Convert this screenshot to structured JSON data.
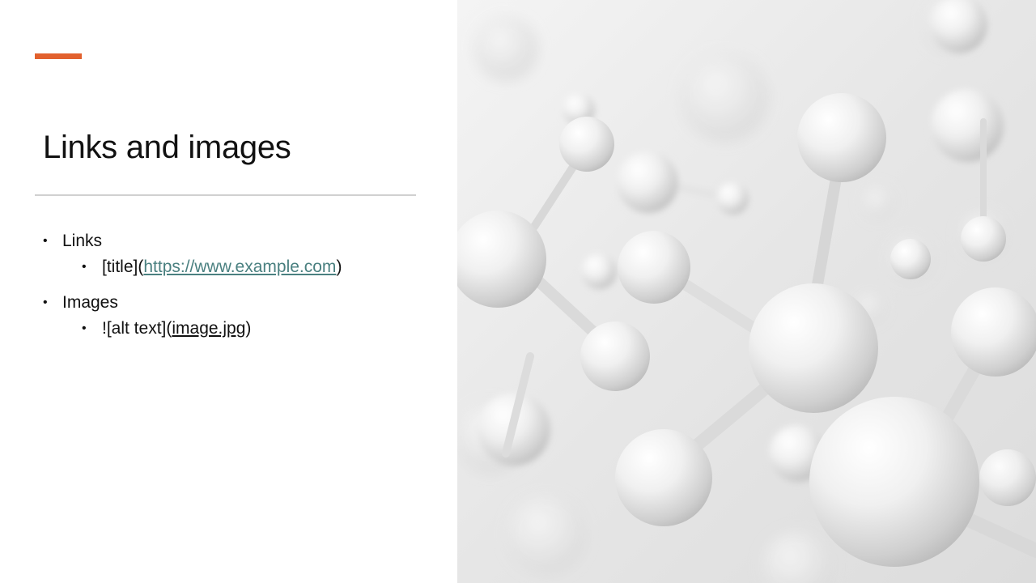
{
  "slide": {
    "title": "Links and images",
    "accent_color": "#e2612e",
    "bullets": [
      {
        "label": "Links",
        "sub": {
          "prefix": "[title](",
          "link_text": "https://www.example.com",
          "suffix": ")"
        }
      },
      {
        "label": "Images",
        "sub": {
          "prefix": "![alt text](",
          "link_text": "image.jpg",
          "suffix": ")"
        }
      }
    ],
    "image": {
      "subject": "molecule-image",
      "palette": [
        "#f2f2f2",
        "#d9d9d9",
        "#b8b8b8"
      ]
    }
  }
}
